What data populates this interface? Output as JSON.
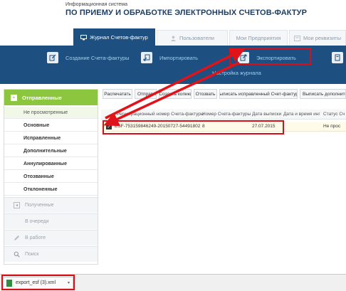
{
  "header": {
    "subtitle": "Информационная система",
    "title": "ПО ПРИЕМУ И ОБРАБОТКЕ ЭЛЕКТРОННЫХ СЧЕТОВ-ФАКТУР"
  },
  "tabs": [
    {
      "label": "Журнал Счетов-фактур",
      "icon": "monitor-icon",
      "active": true
    },
    {
      "label": "Пользователи",
      "icon": "user-icon"
    },
    {
      "label": "Мои Предприятия",
      "icon": ""
    },
    {
      "label": "Мои реквизиты",
      "icon": "card-icon"
    }
  ],
  "toolbar": {
    "create_label": "Создание Счета-фактуры",
    "import_label": "Импортировать",
    "export_label": "Экспортировать",
    "config_label": "Настройка журнала"
  },
  "sidebar": {
    "header_label": "Отправленные",
    "items": [
      {
        "label": "Не просмотренные"
      },
      {
        "label": "Основные"
      },
      {
        "label": "Исправленные"
      },
      {
        "label": "Дополнительные"
      },
      {
        "label": "Аннулированные"
      },
      {
        "label": "Отозванные"
      },
      {
        "label": "Отклоненные"
      }
    ],
    "sections": [
      {
        "label": "Полученные"
      },
      {
        "label": "В очереди"
      },
      {
        "label": "В работе"
      },
      {
        "label": "Поиск"
      }
    ]
  },
  "content": {
    "buttons": [
      "Распечатать",
      "Отправить",
      "Создать копию",
      "Отозвать",
      "Выписать исправленный Счет-фактуру",
      "Выписать дополнительный"
    ],
    "columns": [
      "Регистрационный номер Счета-фактуры",
      "Номер Счета-фактуры",
      "Дата выписки",
      "Дата и время инг",
      "Статус Сч"
    ],
    "row": {
      "reg_number": "ESF-753159846249-20150727-54491802",
      "number": "8",
      "date": "27.07.2015",
      "datetime": "",
      "status": "Не прос"
    }
  },
  "download": {
    "filename": "export_esf (3).xml"
  },
  "colors": {
    "brand_blue": "#1d4f80",
    "accent_green": "#8cc63f",
    "highlight_red": "#d80f16",
    "toolbar_text": "#9fd0ec"
  }
}
